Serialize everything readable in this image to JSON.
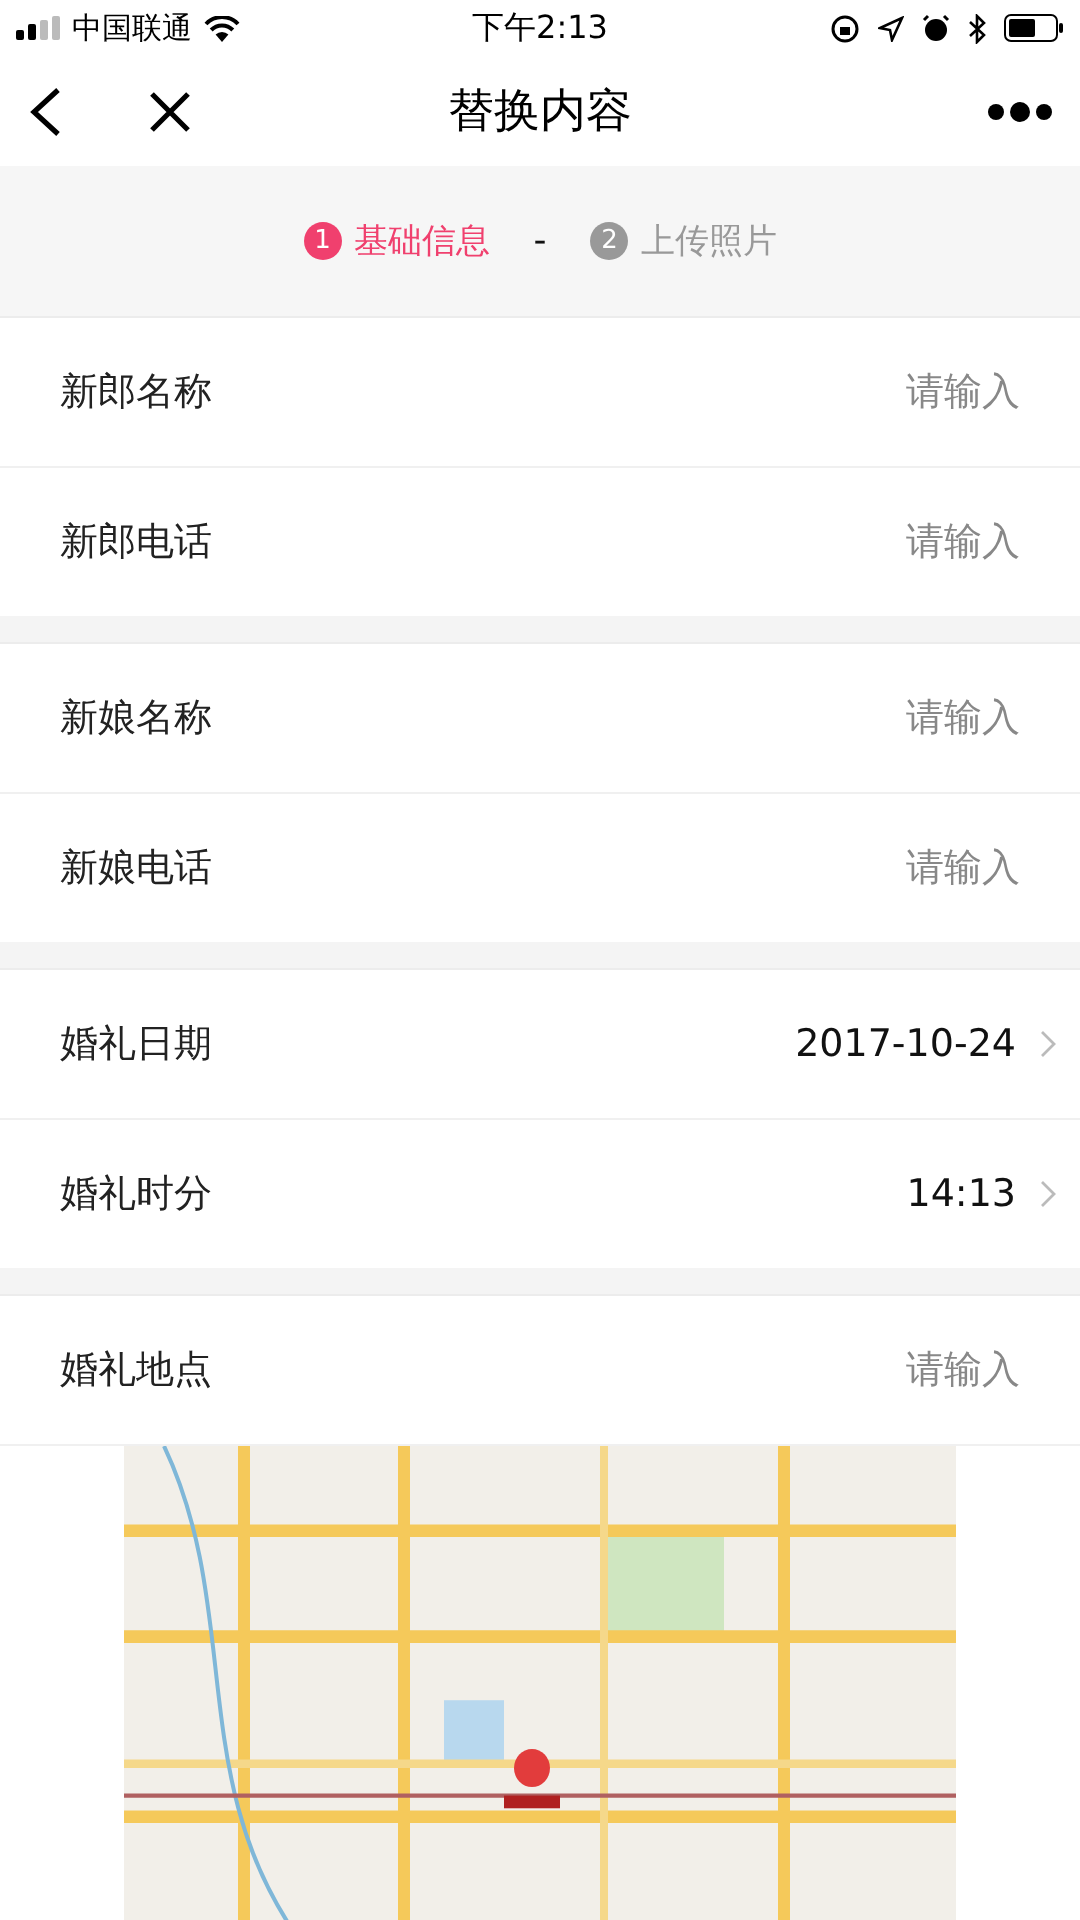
{
  "status_bar": {
    "carrier": "中国联通",
    "time": "下午2:13"
  },
  "nav": {
    "title": "替换内容"
  },
  "steps": [
    {
      "number": "1",
      "label": "基础信息",
      "selected": true
    },
    {
      "number": "2",
      "label": "上传照片",
      "selected": false
    }
  ],
  "step_separator": "-",
  "groups": [
    {
      "rows": [
        {
          "kind": "input",
          "label": "新郎名称",
          "placeholder": "请输入"
        },
        {
          "kind": "input",
          "label": "新郎电话",
          "placeholder": "请输入"
        }
      ]
    },
    {
      "rows": [
        {
          "kind": "input",
          "label": "新娘名称",
          "placeholder": "请输入"
        },
        {
          "kind": "input",
          "label": "新娘电话",
          "placeholder": "请输入"
        }
      ]
    },
    {
      "rows": [
        {
          "kind": "picker",
          "label": "婚礼日期",
          "value": "2017-10-24"
        },
        {
          "kind": "picker",
          "label": "婚礼时分",
          "value": "14:13"
        }
      ]
    },
    {
      "rows": [
        {
          "kind": "input",
          "label": "婚礼地点",
          "placeholder": "请输入"
        },
        {
          "kind": "map"
        }
      ]
    }
  ]
}
